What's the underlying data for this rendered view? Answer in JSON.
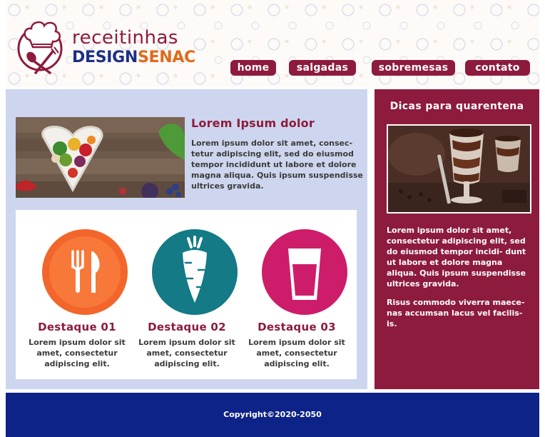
{
  "brand": {
    "name_top": "receitinhas",
    "name_design": "DESIGN",
    "name_senac": "SENAC"
  },
  "nav": [
    {
      "label": "home"
    },
    {
      "label": "salgadas"
    },
    {
      "label": "sobremesas"
    },
    {
      "label": "contato"
    }
  ],
  "article": {
    "title": "Lorem Ipsum dolor",
    "body": "Lorem ipsum dolor sit amet, consec- tetur adipiscing elit, sed do eiusmod tempor incididunt ut labore et dolore magna aliqua. Quis ipsum suspendisse ultrices gravida."
  },
  "highlights": [
    {
      "icon": "cutlery-icon",
      "color": "#f2662b",
      "title": "Destaque 01",
      "text": "Lorem ipsum dolor sit amet, consectetur adipiscing elit."
    },
    {
      "icon": "carrot-icon",
      "color": "#137a86",
      "title": "Destaque 02",
      "text": "Lorem ipsum dolor sit amet, consectetur adipiscing elit."
    },
    {
      "icon": "glass-icon",
      "color": "#cd1d6a",
      "title": "Destaque 03",
      "text": "Lorem ipsum dolor sit amet, consectetur adipiscing elit."
    }
  ],
  "sidebar": {
    "title": "Dicas para quarentena",
    "paragraph1": "Lorem ipsum dolor sit amet, consectetur adipiscing elit, sed do eiusmod tempor incidi- dunt ut labore et dolore magna aliqua. Quis ipsum suspendisse ultrices gravida.",
    "paragraph2": "Risus commodo viverra maece- nas accumsan lacus vel facilis- is."
  },
  "footer": {
    "copyright": "Copyright©2020-2050"
  },
  "colors": {
    "wine": "#8d1b3d",
    "navy": "#0d2387",
    "main_bg": "#cdd6ee",
    "senac_orange": "#e06a1b"
  }
}
